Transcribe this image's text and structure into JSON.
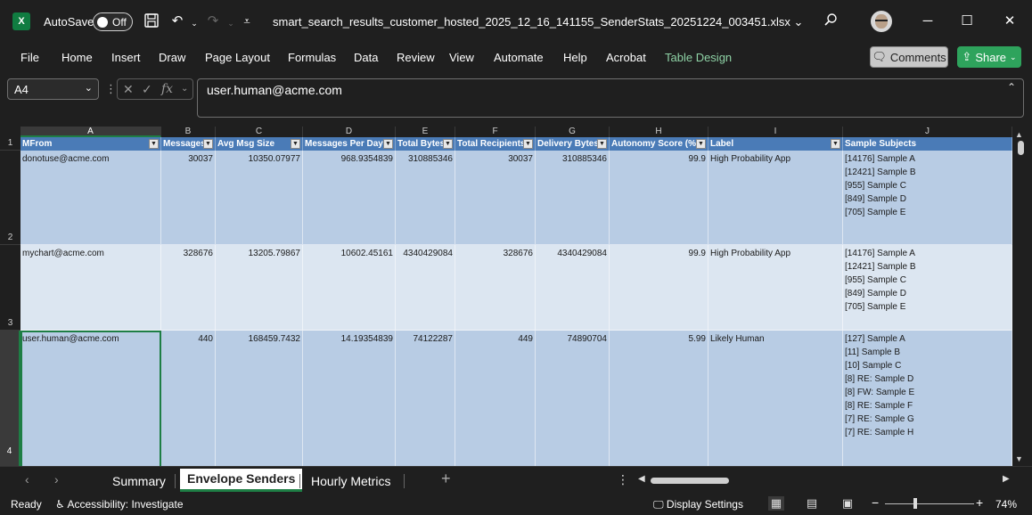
{
  "title_bar": {
    "autosave_label": "AutoSave",
    "autosave_state": "Off",
    "filename": "smart_search_results_customer_hosted_2025_12_16_141155_SenderStats_20251224_003451.xlsx",
    "icons": [
      "excel-logo-icon",
      "save-icon",
      "undo-icon",
      "redo-icon",
      "customize-icon",
      "search-icon",
      "minimize-icon",
      "maximize-icon",
      "close-icon"
    ]
  },
  "menu": {
    "items": [
      "File",
      "Home",
      "Insert",
      "Draw",
      "Page Layout",
      "Formulas",
      "Data",
      "Review",
      "View",
      "Automate",
      "Help",
      "Acrobat",
      "Table Design"
    ],
    "comments_label": "Comments",
    "share_label": "Share"
  },
  "formula_bar": {
    "name_box": "A4",
    "fx_label": "fx",
    "formula": "user.human@acme.com"
  },
  "grid": {
    "column_letters": [
      "A",
      "B",
      "C",
      "D",
      "E",
      "F",
      "G",
      "H",
      "I",
      "J"
    ],
    "row_numbers": [
      "1",
      "2",
      "3",
      "4"
    ],
    "headers": [
      "MFrom",
      "Messages",
      "Avg Msg Size",
      "Messages Per Day",
      "Total Bytes",
      "Total Recipients",
      "Delivery Bytes",
      "Autonomy Score (%)",
      "Label",
      "Sample Subjects"
    ],
    "rows": [
      {
        "mfrom": "donotuse@acme.com",
        "messages": "30037",
        "avg_msg_size": "10350.07977",
        "messages_per_day": "968.9354839",
        "total_bytes": "310885346",
        "total_recipients": "30037",
        "delivery_bytes": "310885346",
        "autonomy_score": "99.9",
        "label": "High Probability App",
        "subjects": [
          "[14176] Sample A",
          "[12421] Sample B",
          "[955] Sample C",
          "[849] Sample D",
          "[705] Sample E"
        ]
      },
      {
        "mfrom": "mychart@acme.com",
        "messages": "328676",
        "avg_msg_size": "13205.79867",
        "messages_per_day": "10602.45161",
        "total_bytes": "4340429084",
        "total_recipients": "328676",
        "delivery_bytes": "4340429084",
        "autonomy_score": "99.9",
        "label": "High Probability App",
        "subjects": [
          "[14176] Sample A",
          "[12421] Sample B",
          "[955] Sample C",
          "[849] Sample D",
          "[705] Sample E"
        ]
      },
      {
        "mfrom": "user.human@acme.com",
        "messages": "440",
        "avg_msg_size": "168459.7432",
        "messages_per_day": "14.19354839",
        "total_bytes": "74122287",
        "total_recipients": "449",
        "delivery_bytes": "74890704",
        "autonomy_score": "5.99",
        "label": "Likely Human",
        "subjects": [
          "[127] Sample A",
          "[11] Sample B",
          "[10] Sample C",
          "[8] RE: Sample D",
          "[8] FW: Sample E",
          "[8] RE: Sample F",
          "[7] RE: Sample G",
          "[7] RE: Sample H"
        ]
      }
    ]
  },
  "sheet_tabs": {
    "tabs": [
      "Summary",
      "Envelope Senders",
      "Hourly Metrics"
    ],
    "active": "Envelope Senders"
  },
  "status_bar": {
    "ready": "Ready",
    "accessibility": "Accessibility: Investigate",
    "display_settings": "Display Settings",
    "zoom": "74%"
  }
}
